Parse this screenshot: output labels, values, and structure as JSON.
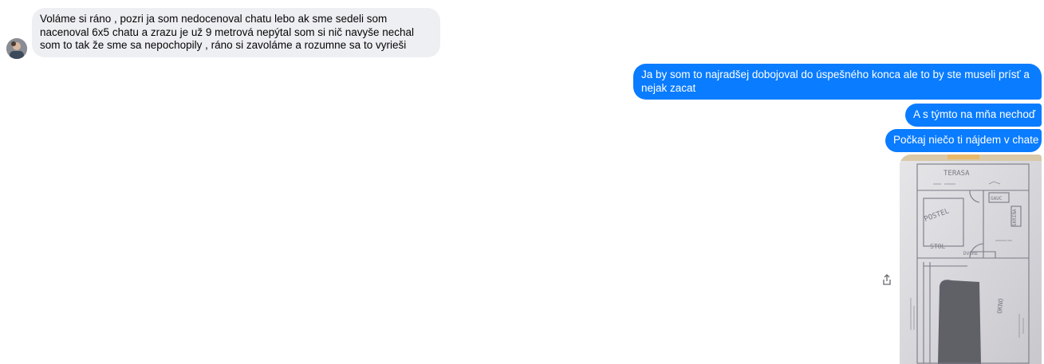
{
  "conversation": {
    "incoming": {
      "text": "Voláme si ráno , pozri ja som nedocenoval chatu lebo ak sme sedeli som nacenoval 6x5 chatu a zrazu je už 9 metrová nepýtal som si nič navyše nechal som to tak že sme sa nepochopily , ráno si zavoláme a rozumne sa to vyrieši",
      "avatar_icon": "user-avatar"
    },
    "outgoing": [
      {
        "text": "Ja by som to najradšej dobojoval do úspešného konca ale to by ste museli prísť a nejak zacat"
      },
      {
        "text": "A s týmto na mňa nechoď"
      },
      {
        "text": "Počkaj niečo ti nájdem v chate"
      }
    ],
    "attachment": {
      "kind": "photo",
      "sketch_labels": [
        "TERASA",
        "POSTEL",
        "STOL",
        "DVERE",
        "GAUC",
        "SKRIŇA",
        "OKNO"
      ],
      "share_icon": "share-icon"
    }
  },
  "colors": {
    "incoming_bg": "#eeeff2",
    "outgoing_bg": "#0a7cff",
    "outgoing_text": "#ffffff",
    "page_bg": "#ffffff"
  }
}
